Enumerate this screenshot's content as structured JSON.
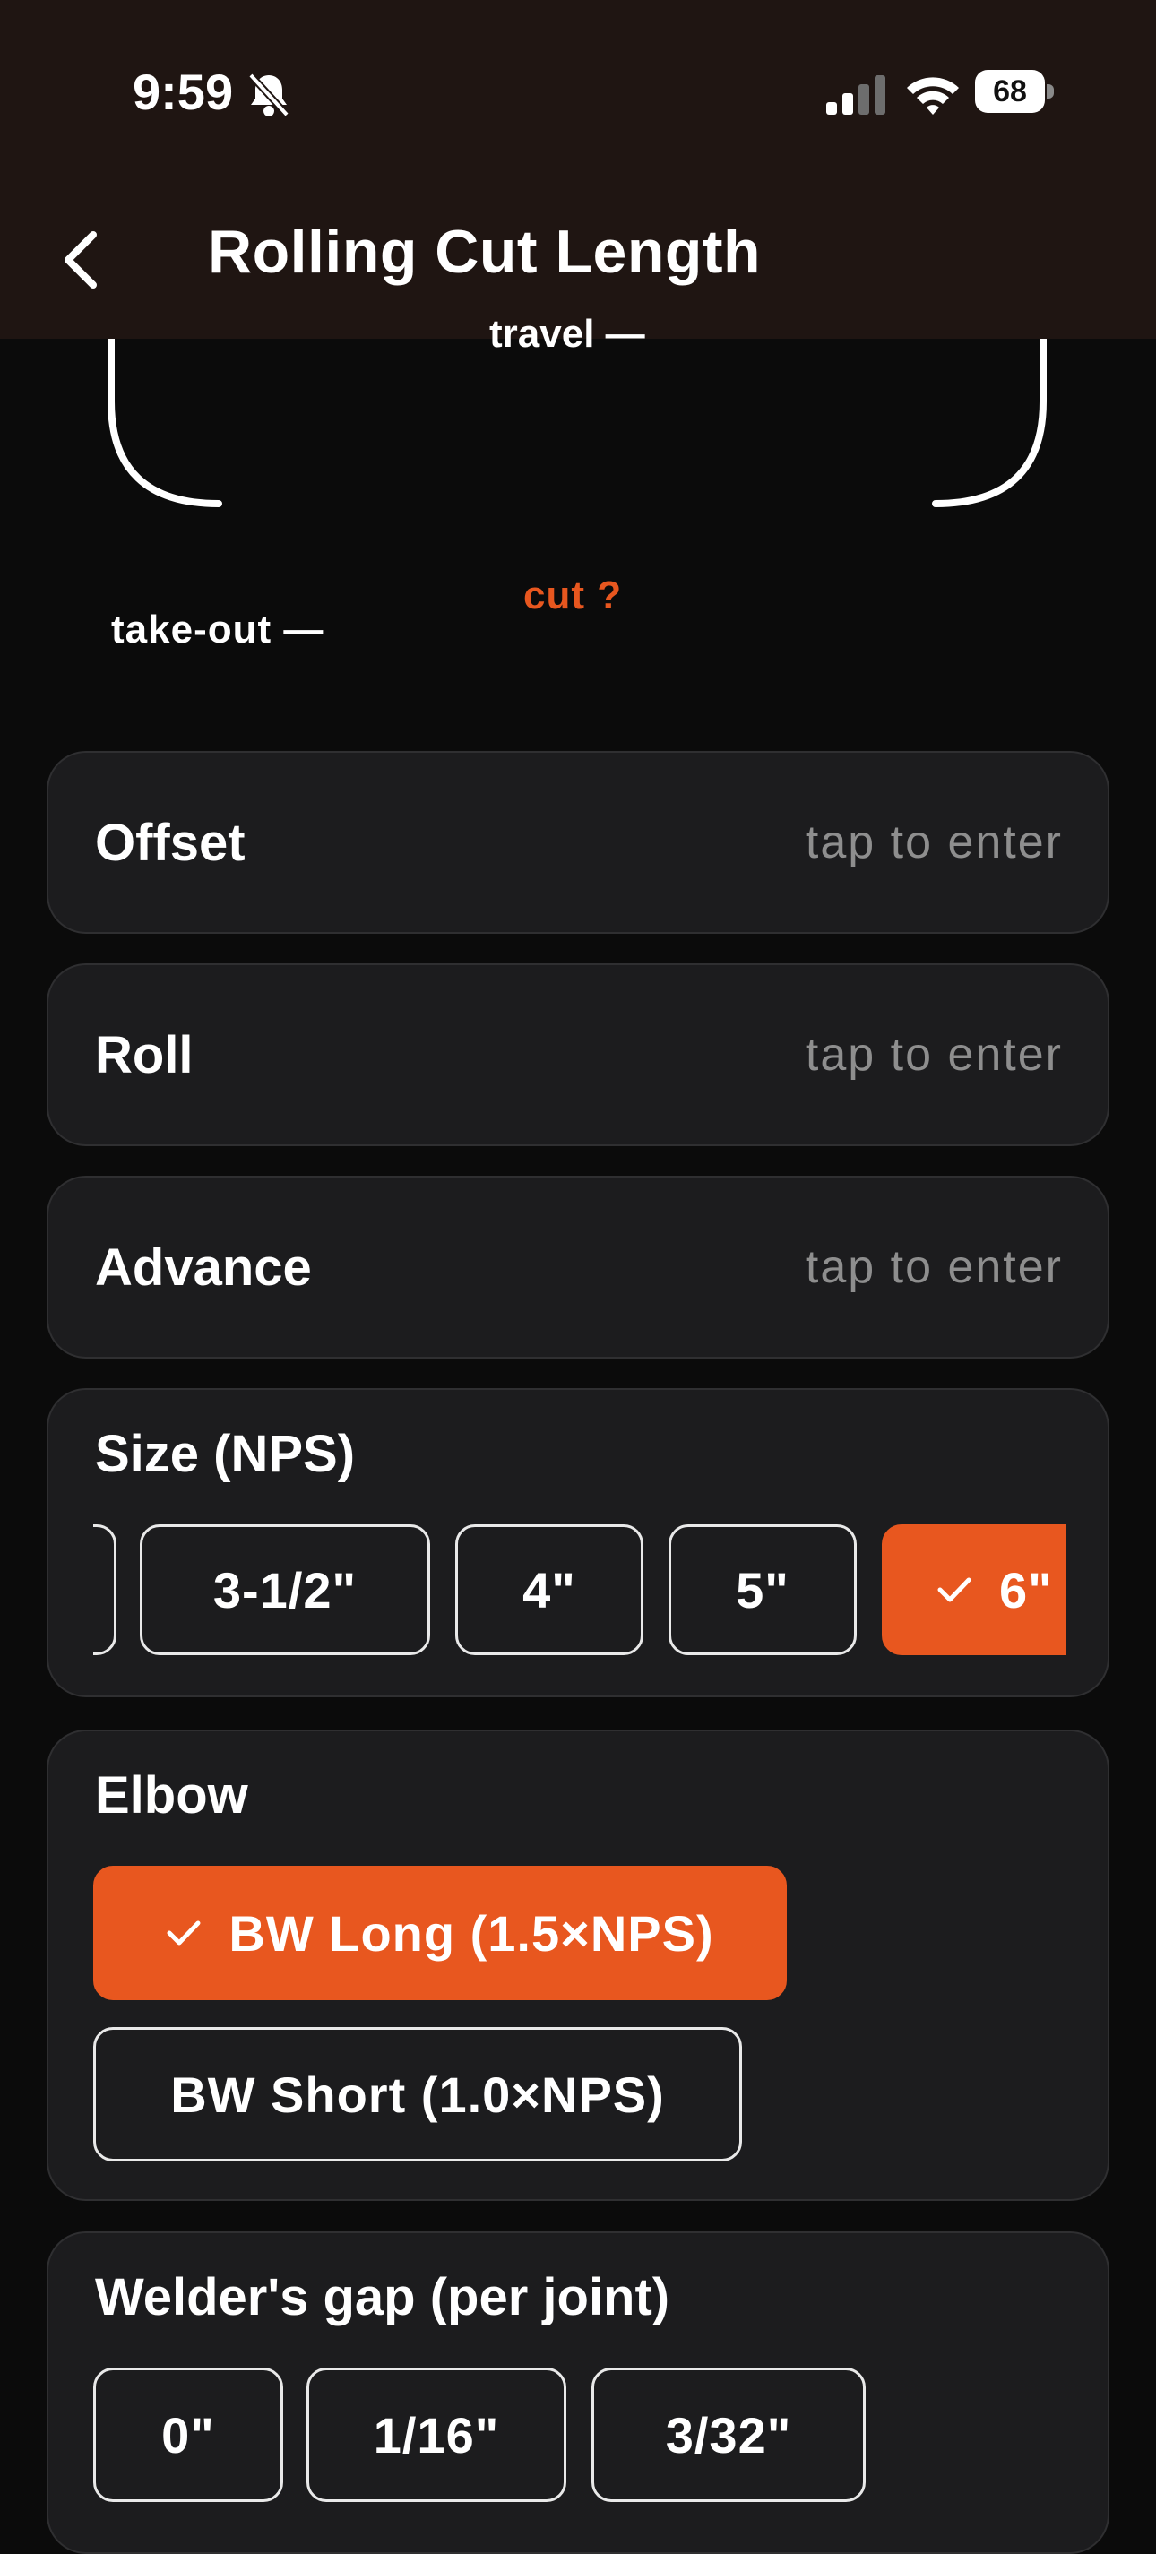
{
  "status_bar": {
    "time": "9:59",
    "battery": "68"
  },
  "nav": {
    "title": "Rolling Cut Length"
  },
  "diagram": {
    "travel_label": "travel —",
    "takeout_label": "take-out —",
    "cut_label": "cut ?"
  },
  "fields": [
    {
      "label": "Offset",
      "hint": "tap to enter"
    },
    {
      "label": "Roll",
      "hint": "tap to enter"
    },
    {
      "label": "Advance",
      "hint": "tap to enter"
    }
  ],
  "size": {
    "heading": "Size (NPS)",
    "options": [
      "3-1/2\"",
      "4\"",
      "5\"",
      "6\""
    ],
    "selected": "6\""
  },
  "elbow": {
    "heading": "Elbow",
    "options": [
      "BW Long (1.5×NPS)",
      "BW Short (1.0×NPS)"
    ],
    "selected": "BW Long (1.5×NPS)"
  },
  "gap": {
    "heading": "Welder's gap (per joint)",
    "options": [
      "0\"",
      "1/16\"",
      "3/32\""
    ]
  },
  "colors": {
    "accent": "#e8571f",
    "background": "#0b0b0b",
    "card": "#1c1c1e",
    "header": "#1f1512"
  }
}
